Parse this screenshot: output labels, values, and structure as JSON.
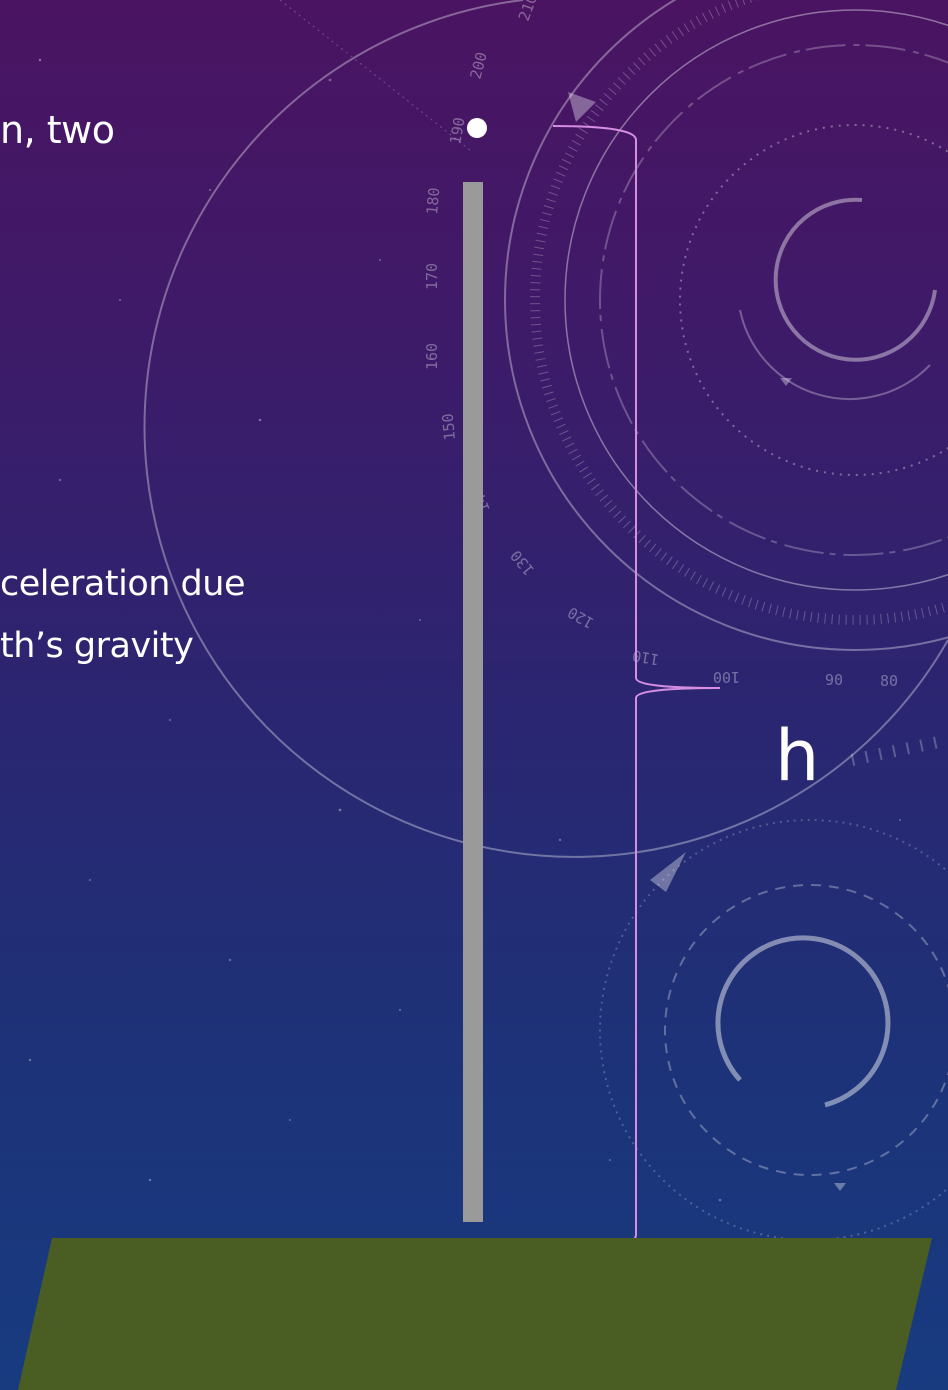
{
  "slide": {
    "text_line_1": "n, two",
    "text_line_2": "celeration due",
    "text_line_3": "th’s gravity",
    "height_label": "h"
  },
  "scene": {
    "pole_color": "#9a9a9a",
    "ball_color": "#ffffff",
    "brace_color": "#d58ee0",
    "ground_color": "#4a5e23"
  },
  "dial_numbers": [
    "210",
    "200",
    "190",
    "180",
    "170",
    "160",
    "150",
    "140",
    "130",
    "120",
    "110",
    "100",
    "90",
    "80"
  ]
}
